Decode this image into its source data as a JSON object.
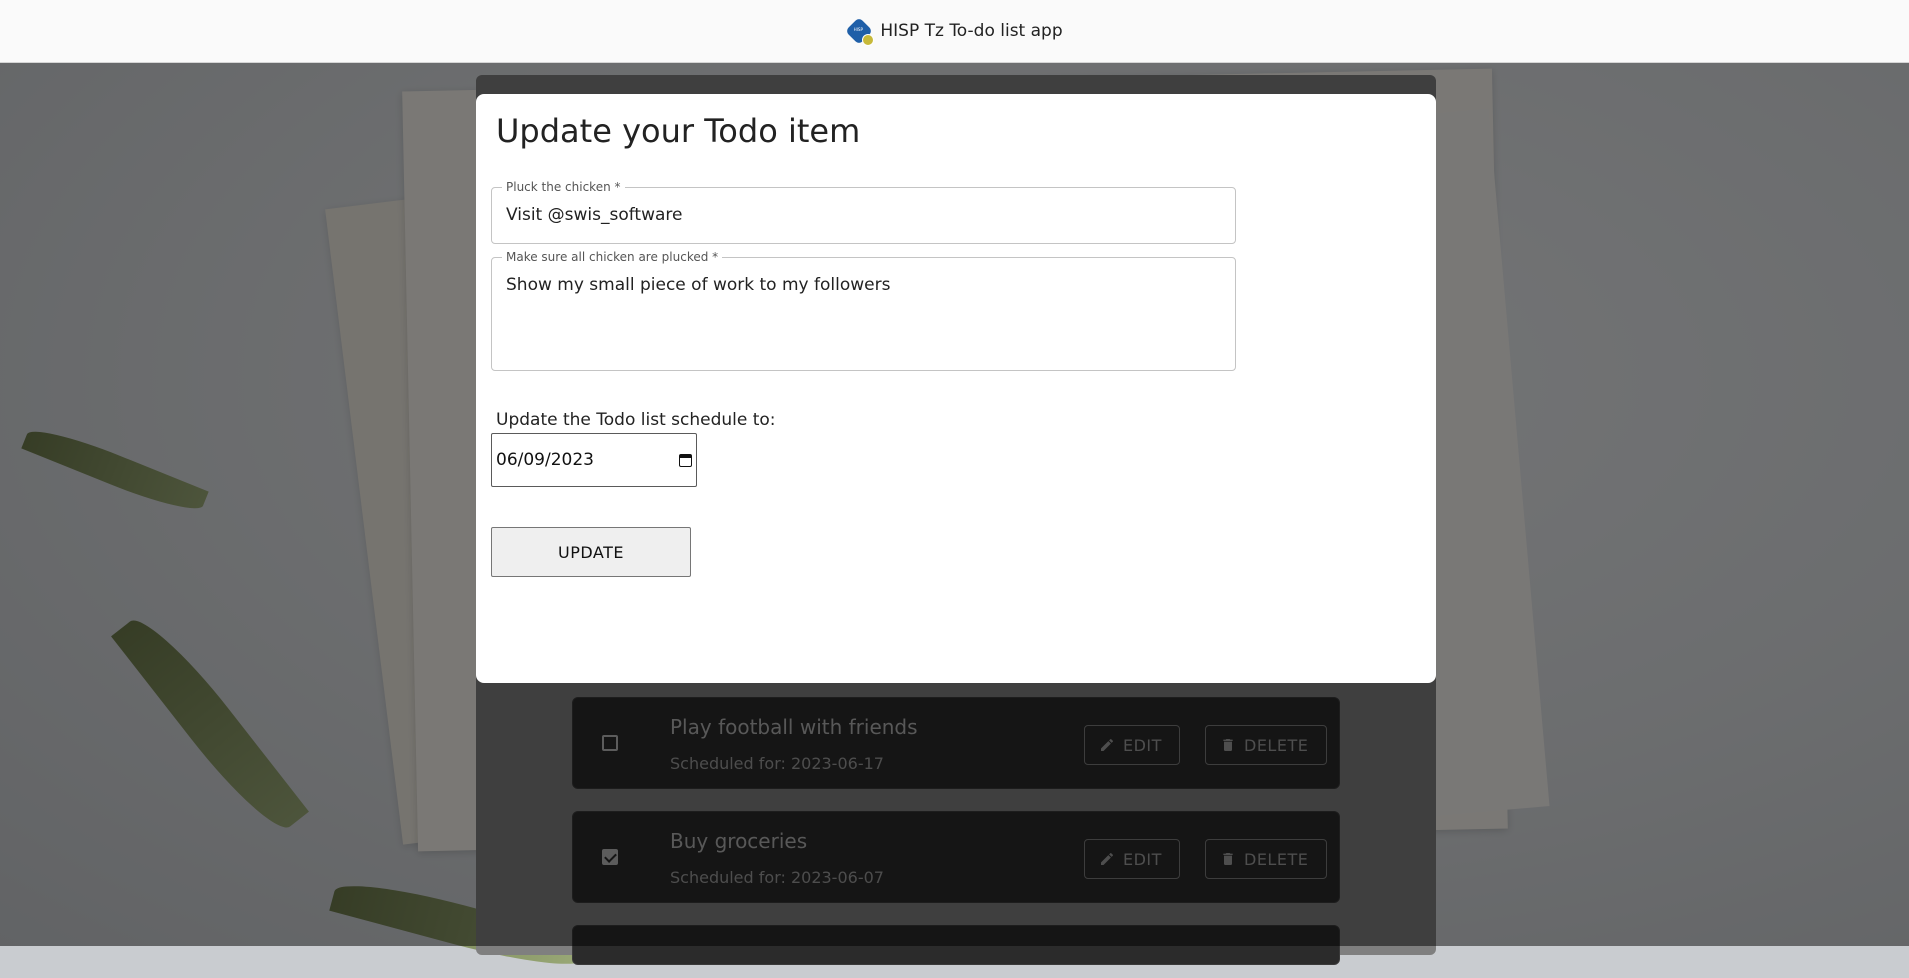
{
  "app": {
    "title": "HISP Tz To-do list app",
    "logo_icon": "hisp-logo-icon"
  },
  "modal": {
    "title": "Update your Todo item",
    "title_field": {
      "label": "Pluck the chicken",
      "value": "Visit @swis_software"
    },
    "description_field": {
      "label": "Make sure all chicken are plucked",
      "value": "Show my small piece of work to my followers"
    },
    "schedule_label": "Update the Todo list schedule to:",
    "date_value": "06/09/2023",
    "update_label": "UPDATE"
  },
  "todos": [
    {
      "title": "Play football with friends",
      "schedule": "Scheduled for: 2023-06-17",
      "checked": false,
      "edit_label": "EDIT",
      "delete_label": "DELETE"
    },
    {
      "title": "Buy groceries",
      "schedule": "Scheduled for: 2023-06-07",
      "checked": true,
      "edit_label": "EDIT",
      "delete_label": "DELETE"
    }
  ],
  "colors": {
    "header_bg": "#fafafa",
    "modal_bg": "#ffffff",
    "card_bg": "#2b2b2b"
  }
}
